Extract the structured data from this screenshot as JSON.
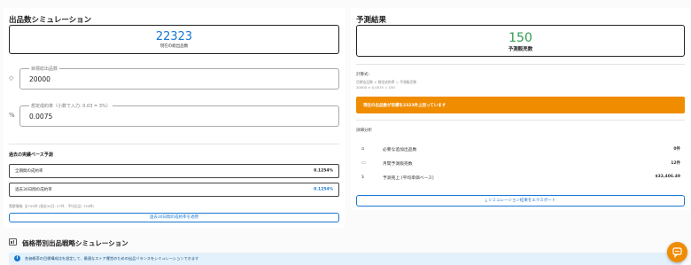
{
  "simulation": {
    "title": "出品数シミュレーション",
    "current_total_value": "22323",
    "current_total_caption": "現在の総出品数",
    "target_field": {
      "label": "目標総出品数",
      "value": "20000"
    },
    "rate_field": {
      "label": "想定成約率（小数で入力: 0.03 = 3%）",
      "value": "0.0075"
    }
  },
  "history": {
    "title": "過去の実績ベース予測",
    "rows": [
      {
        "label": "全期間の成約率",
        "value": "0.1254%"
      },
      {
        "label": "過去30日間の成約率",
        "value": "0.1254%"
      }
    ],
    "note": "実績情報: 全759件 (過去30日: 27件、平均出品: 759件)",
    "apply_button": "過去30日間の成約率を適用"
  },
  "result": {
    "title": "予測結果",
    "value": "150",
    "caption": "予測販売数",
    "formula_title": "計算式:",
    "formula_line1": "目標出品数 × 想定成約率 = 予測販売数",
    "formula_line2": "20000 × 0.0075 = 150",
    "warning": "現在の出品数が目標を2323件上回っています",
    "detail_title": "詳細分析",
    "details": [
      {
        "icon": "chart-icon",
        "label": "必要な追加出品数",
        "value": "0件"
      },
      {
        "icon": "calendar-icon",
        "label": "月間予測販売数",
        "value": "12件"
      },
      {
        "icon": "dollar-icon",
        "label": "予測売上 (平均単価ベース)",
        "value": "$32,406.49"
      }
    ],
    "export_button": "シミュレーション結果をエクスポート"
  },
  "bottom": {
    "title": "価格帯別出品戦略シミュレーション",
    "info": "各価格帯の目標構成比を設定して、最適なストア運営のための出品バランスをシミュレーションできます"
  },
  "colors": {
    "accent": "#1976d2",
    "warning": "#f08c00",
    "success": "#2e9d4f"
  }
}
